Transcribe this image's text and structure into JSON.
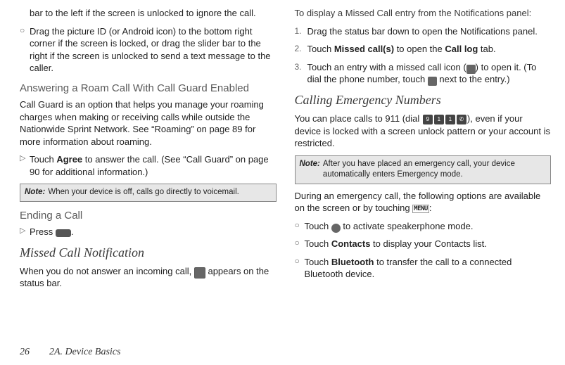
{
  "left": {
    "frag1": "bar to the left if the screen is unlocked to ignore the call.",
    "bullet1": "Drag the picture ID (or Android icon) to the bottom right corner if the screen is locked, or drag the slider bar to the right if the screen is unlocked to send a text message to the caller.",
    "h1": "Answering a Roam Call With Call Guard Enabled",
    "p1": "Call Guard is an option that helps you manage your roaming charges when making or receiving calls while outside the Nationwide Sprint Network. See “Roaming” on page 89 for more information about roaming.",
    "action1_pre": "Touch ",
    "action1_bold": "Agree",
    "action1_post": " to answer the call.  (See “Call Guard” on page 90 for additional information.)",
    "note_label": "Note:",
    "note_text": "When your device is off, calls go directly to voicemail.",
    "h2": "Ending a  Call",
    "action2_pre": "Press ",
    "action2_post": ".",
    "h3": "Missed Call Notification",
    "p2_pre": "When you do not answer an incoming call, ",
    "p2_post": " appears on the status bar."
  },
  "right": {
    "instr": "To display a Missed Call entry from the Notifications panel:",
    "step1": "Drag the status bar down to open the Notifications panel.",
    "step2_pre": "Touch ",
    "step2_b1": "Missed call(s)",
    "step2_mid": " to open the ",
    "step2_b2": "Call log",
    "step2_post": " tab.",
    "step3_pre": "Touch an entry with a missed call icon (",
    "step3_mid": ") to open it. (To dial the phone number, touch ",
    "step3_post": " next to the entry.)",
    "h1": "Calling Emergency Numbers",
    "p1_pre": "You can place calls to 911 (dial ",
    "p1_post": "), even if your device is locked with a screen unlock pattern or your account is restricted.",
    "note_label": "Note:",
    "note_text": "After you have placed an emergency call, your device automatically enters Emergency mode.",
    "p2_pre": "During an emergency call, the following options are available on the screen or by touching ",
    "p2_post": ":",
    "b1_pre": "Touch ",
    "b1_post": " to activate speakerphone mode.",
    "b2_pre": "Touch ",
    "b2_bold": "Contacts",
    "b2_post": " to display your Contacts list.",
    "b3_pre": "Touch ",
    "b3_bold": "Bluetooth",
    "b3_post": " to transfer the call to a connected Bluetooth device."
  },
  "footer": {
    "page_num": "26",
    "section": "2A. Device Basics"
  },
  "icons": {
    "menu_label": "MENU",
    "key9": "9",
    "key1a": "1",
    "key1b": "1",
    "keycall": "✆"
  }
}
